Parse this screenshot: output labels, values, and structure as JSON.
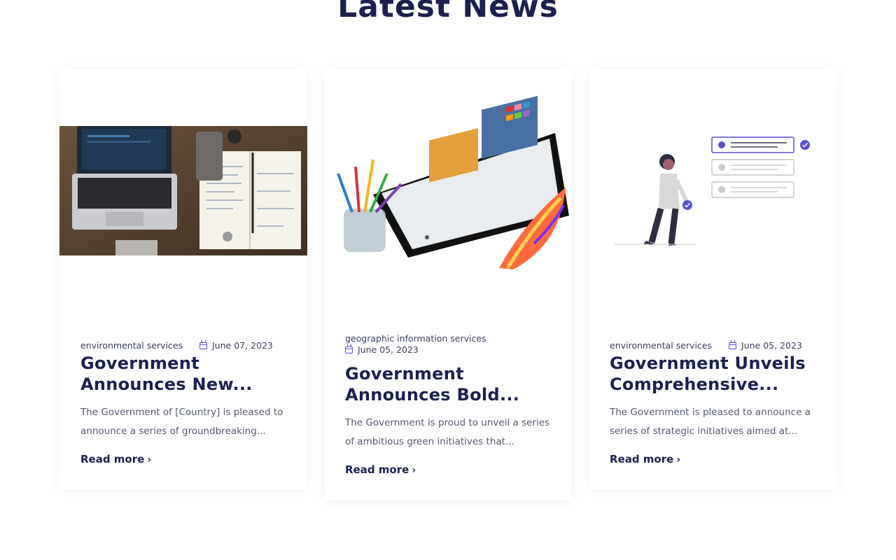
{
  "section": {
    "title": "Latest News"
  },
  "posts": [
    {
      "category": "environmental services",
      "date": "June 07, 2023",
      "title": "Government Announces New...",
      "excerpt": "The Government of [Country] is pleased to announce a series of groundbreaking...",
      "read_more": "Read more",
      "image_icon": "laptop-desk-photo"
    },
    {
      "category": "geographic information services",
      "date": "June 05, 2023",
      "title": "Government Announces Bold...",
      "excerpt": "The Government is proud to unveil a series of ambitious green initiatives that...",
      "read_more": "Read more",
      "image_icon": "design-software-monitor"
    },
    {
      "category": "environmental services",
      "date": "June 05, 2023",
      "title": "Government Unveils Comprehensive...",
      "excerpt": "The Government is pleased to announce a series of strategic initiatives aimed at...",
      "read_more": "Read more",
      "image_icon": "checklist-illustration"
    }
  ],
  "colors": {
    "heading": "#1c2050",
    "accent": "#5a4fd6",
    "text": "#555a70"
  }
}
